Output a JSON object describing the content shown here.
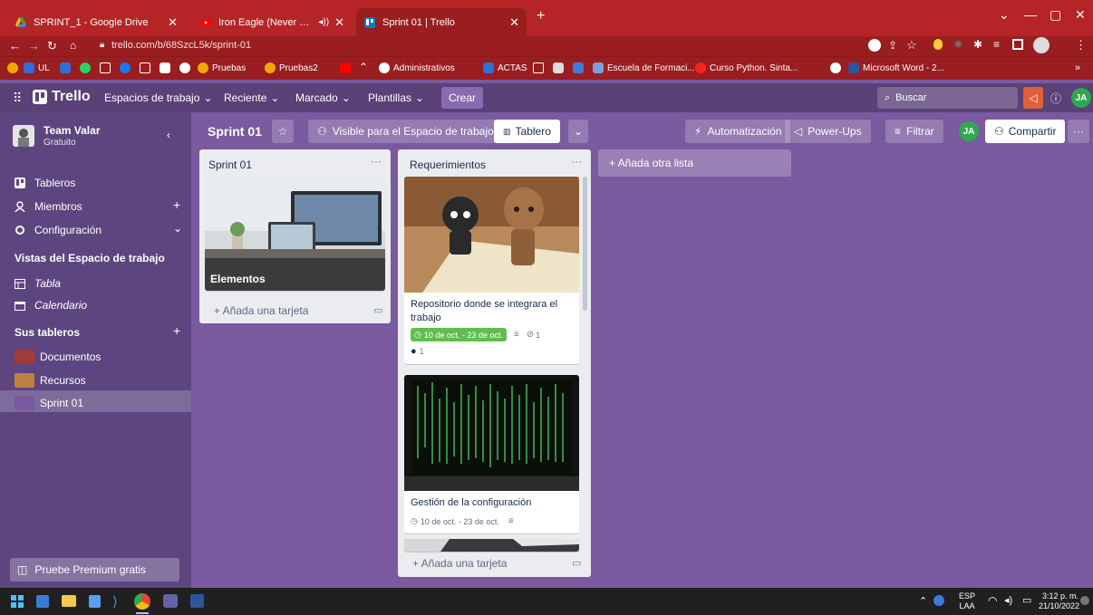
{
  "browser": {
    "tabs": [
      {
        "label": "SPRINT_1 - Google Drive",
        "active": false
      },
      {
        "label": "Iron Eagle (Never Say Die) - ",
        "active": false
      },
      {
        "label": "Sprint 01 | Trello",
        "active": true
      }
    ],
    "url": "trello.com/b/68SzcL5k/sprint-01",
    "bookmarks": [
      {
        "label": "UL",
        "color": "#2f6fd6"
      },
      {
        "label": "Pruebas",
        "color": "#f0a800"
      },
      {
        "label": "Pruebas2",
        "color": "#f0a800"
      },
      {
        "label": "Administrativos",
        "color": "#ffffff"
      },
      {
        "label": "ACTAS",
        "color": "#2f6fd6"
      },
      {
        "label": "Escuela de Formaci...",
        "color": "#7aa0e0"
      },
      {
        "label": "Curso Python. Sinta...",
        "color": "#ff2020"
      },
      {
        "label": "Microsoft Word - 2...",
        "color": "#2b579a"
      }
    ],
    "more": "»"
  },
  "header": {
    "logo": "Trello",
    "nav": [
      "Espacios de trabajo",
      "Reciente",
      "Marcado",
      "Plantillas"
    ],
    "create": "Crear",
    "search_placeholder": "Buscar",
    "avatar": "JA"
  },
  "sidebar": {
    "workspace_name": "Team Valar",
    "workspace_plan": "Gratuito",
    "items": [
      "Tableros",
      "Miembros",
      "Configuración"
    ],
    "views_title": "Vistas del Espacio de trabajo",
    "views": [
      "Tabla",
      "Calendario"
    ],
    "boards_title": "Sus tableros",
    "boards": [
      {
        "label": "Documentos",
        "color": "#a23a3a"
      },
      {
        "label": "Recursos",
        "color": "#c08040"
      },
      {
        "label": "Sprint 01",
        "color": "#7a5a9e"
      }
    ],
    "premium": "Pruebe Premium gratis"
  },
  "board": {
    "title": "Sprint 01",
    "visibility": "Visible para el Espacio de trabajo",
    "view": "Tablero",
    "automation": "Automatización",
    "powerups": "Power-Ups",
    "filter": "Filtrar",
    "share": "Compartir",
    "member": "JA",
    "add_list": "+ Añada otra lista"
  },
  "lists": [
    {
      "title": "Sprint 01",
      "cards": [
        {
          "title": "Elementos"
        }
      ],
      "add_card": "+ Añada una tarjeta"
    },
    {
      "title": "Requerimientos",
      "cards": [
        {
          "title": "Repositorio donde se integrara el trabajo",
          "dates": "10 de oct. - 23 de oct.",
          "attachments": "1",
          "github": "1"
        },
        {
          "title": "Gestión de la configuración",
          "dates": "10 de oct. - 23 de oct."
        }
      ],
      "add_card": "+ Añada una tarjeta"
    }
  ],
  "taskbar": {
    "lang": "ESP",
    "lang2": "LAA",
    "time": "3:12 p. m.",
    "date": "21/10/2022"
  }
}
